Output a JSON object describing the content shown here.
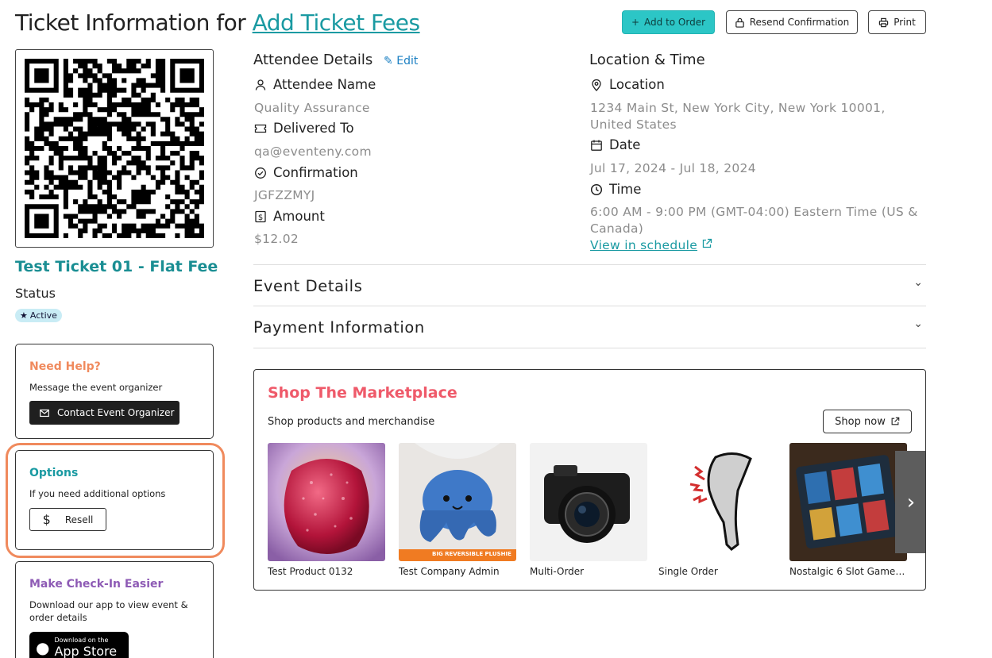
{
  "header": {
    "title_prefix": "Ticket Information for ",
    "title_link": "Add Ticket Fees",
    "add_to_order": "Add to Order",
    "resend_confirmation": "Resend Confirmation",
    "print": "Print"
  },
  "ticket": {
    "name": "Test Ticket 01 - Flat Fee",
    "status_label": "Status",
    "status_value": "Active"
  },
  "help_card": {
    "title": "Need Help?",
    "text": "Message the event organizer",
    "button": "Contact Event Organizer",
    "title_color": "#f08a5d"
  },
  "options_card": {
    "title": "Options",
    "text": "If you need additional options",
    "button": "Resell",
    "title_color": "#1a9aa2"
  },
  "checkin_card": {
    "title": "Make Check-In Easier",
    "text": "Download our app to view event & order details",
    "store_small": "Download on the",
    "store_big": "App Store",
    "title_color": "#8e5bb5"
  },
  "attendee": {
    "heading": "Attendee Details",
    "edit": "Edit",
    "name_label": "Attendee Name",
    "name_value": "Quality Assurance",
    "delivered_label": "Delivered To",
    "delivered_value": "qa@eventeny.com",
    "confirmation_label": "Confirmation",
    "confirmation_value": "JGFZZMYJ",
    "amount_label": "Amount",
    "amount_value": "$12.02"
  },
  "location_time": {
    "heading": "Location & Time",
    "location_label": "Location",
    "location_value": "1234 Main St, New York City, New York 10001, United States",
    "date_label": "Date",
    "date_value": "Jul 17, 2024 - Jul 18, 2024",
    "time_label": "Time",
    "time_value": "6:00 AM - 9:00 PM (GMT-04:00) Eastern Time (US & Canada)",
    "schedule_link": "View in schedule"
  },
  "accordions": {
    "event_details": "Event Details",
    "payment_information": "Payment Information"
  },
  "marketplace": {
    "title": "Shop The Marketplace",
    "subtitle": "Shop products and merchandise",
    "shop_now": "Shop now",
    "plushie_banner": "BIG REVERSIBLE PLUSHIE",
    "products": [
      {
        "name": "Test Product 0132"
      },
      {
        "name": "Test Company Admin"
      },
      {
        "name": "Multi-Order"
      },
      {
        "name": "Single Order"
      },
      {
        "name": "Nostalgic 6 Slot Gameboy ..."
      }
    ]
  },
  "colors": {
    "accent_teal": "#1a9aa2",
    "primary_button": "#2cc6c6",
    "marketplace_title": "#ef5a6a",
    "highlight_ring": "#f08a5d"
  }
}
